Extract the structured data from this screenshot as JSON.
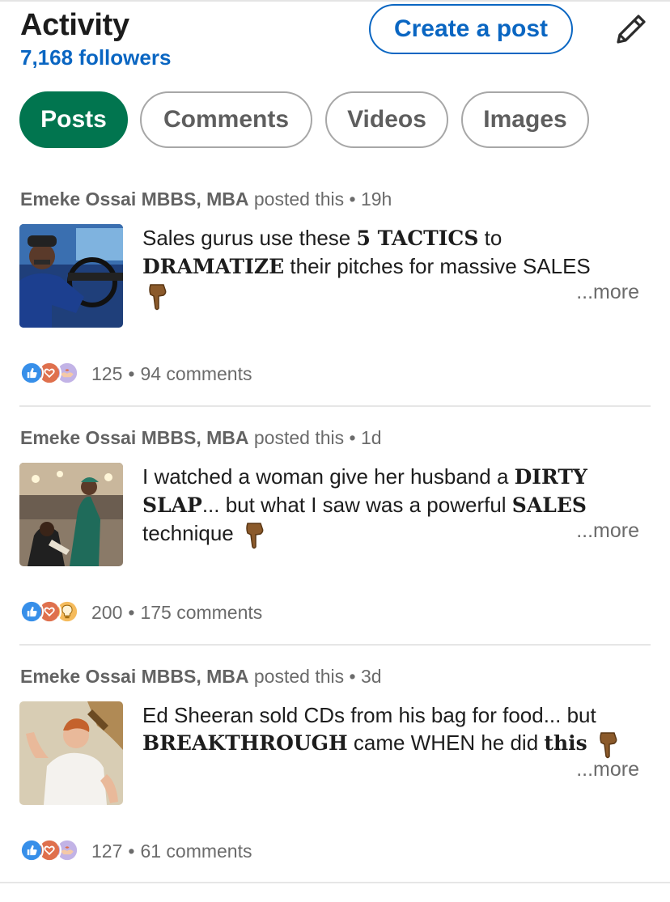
{
  "header": {
    "title": "Activity",
    "followers": "7,168 followers",
    "create_post_label": "Create a post",
    "edit_icon": "pencil-icon"
  },
  "tabs": [
    {
      "label": "Posts",
      "active": true
    },
    {
      "label": "Comments",
      "active": false
    },
    {
      "label": "Videos",
      "active": false
    },
    {
      "label": "Images",
      "active": false
    }
  ],
  "posts": [
    {
      "author": "Emeke Ossai MBBS, MBA",
      "action": "posted this",
      "time": "19h",
      "text": {
        "t1": "Sales gurus use these ",
        "b1": "5 TACTICS",
        "t2": " to",
        "b2": "DRAMATIZE",
        "t3": " their pitches for massive SALES"
      },
      "more": "...more",
      "reaction_icons": [
        "like-icon",
        "love-icon",
        "support-icon"
      ],
      "reactions_count": "125",
      "comments": "94 comments"
    },
    {
      "author": "Emeke Ossai MBBS, MBA",
      "action": "posted this",
      "time": "1d",
      "text": {
        "t1": "I watched a woman give her husband a ",
        "b1": "DIRTY",
        "b2": "SLAP",
        "t2": "... but what I saw was a powerful ",
        "b3": "SALES",
        "t3": "technique"
      },
      "more": "...more",
      "reaction_icons": [
        "like-icon",
        "love-icon",
        "insightful-icon"
      ],
      "reactions_count": "200",
      "comments": "175 comments"
    },
    {
      "author": "Emeke Ossai MBBS, MBA",
      "action": "posted this",
      "time": "3d",
      "text": {
        "t1": "Ed Sheeran sold CDs from his bag for food... but",
        "b1": "BREAKTHROUGH",
        "t2": " came WHEN he did ",
        "b2": "this"
      },
      "more": "...more",
      "reaction_icons": [
        "like-icon",
        "love-icon",
        "support-icon"
      ],
      "reactions_count": "127",
      "comments": "61 comments"
    }
  ],
  "colors": {
    "accent_blue": "#0a66c2",
    "active_tab_green": "#01754f",
    "meta_gray": "#6b6b6b"
  }
}
